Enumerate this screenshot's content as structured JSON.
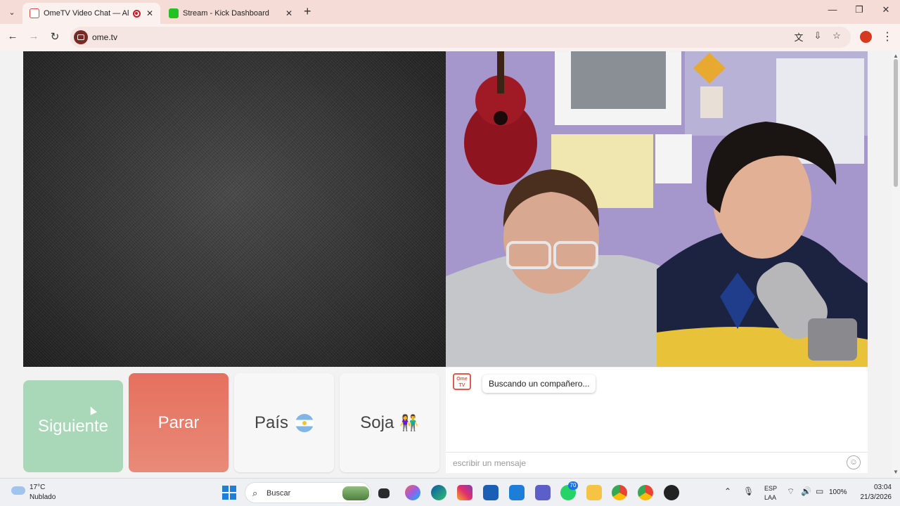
{
  "browser": {
    "tabs": [
      {
        "label": "OmeTV Video Chat — Alter",
        "active": true,
        "favicon_color": "#ffffff"
      },
      {
        "label": "Stream - Kick Dashboard",
        "active": false,
        "favicon_color": "#23c223"
      }
    ],
    "url": "ome.tv"
  },
  "controls": {
    "next_label": "Siguiente",
    "stop_label": "Parar",
    "country_label": "País",
    "gender_label": "Soja",
    "gender_emoji": "👫"
  },
  "chat": {
    "logo_text": "Ome TV",
    "status_message": "Buscando un compañero...",
    "input_placeholder": "escribir un mensaje",
    "emoji_button": "☺"
  },
  "taskbar": {
    "weather_temp": "17°C",
    "weather_desc": "Nublado",
    "search_placeholder": "Buscar",
    "teams_badge": "70",
    "language_code": "ESP",
    "keyboard_layout": "LAA",
    "battery": "100%",
    "time": "03:04",
    "date": "21/3/2026"
  },
  "colors": {
    "next": "#a9d8b8",
    "stop": "#e6705e",
    "accent": "#e25a4a"
  }
}
